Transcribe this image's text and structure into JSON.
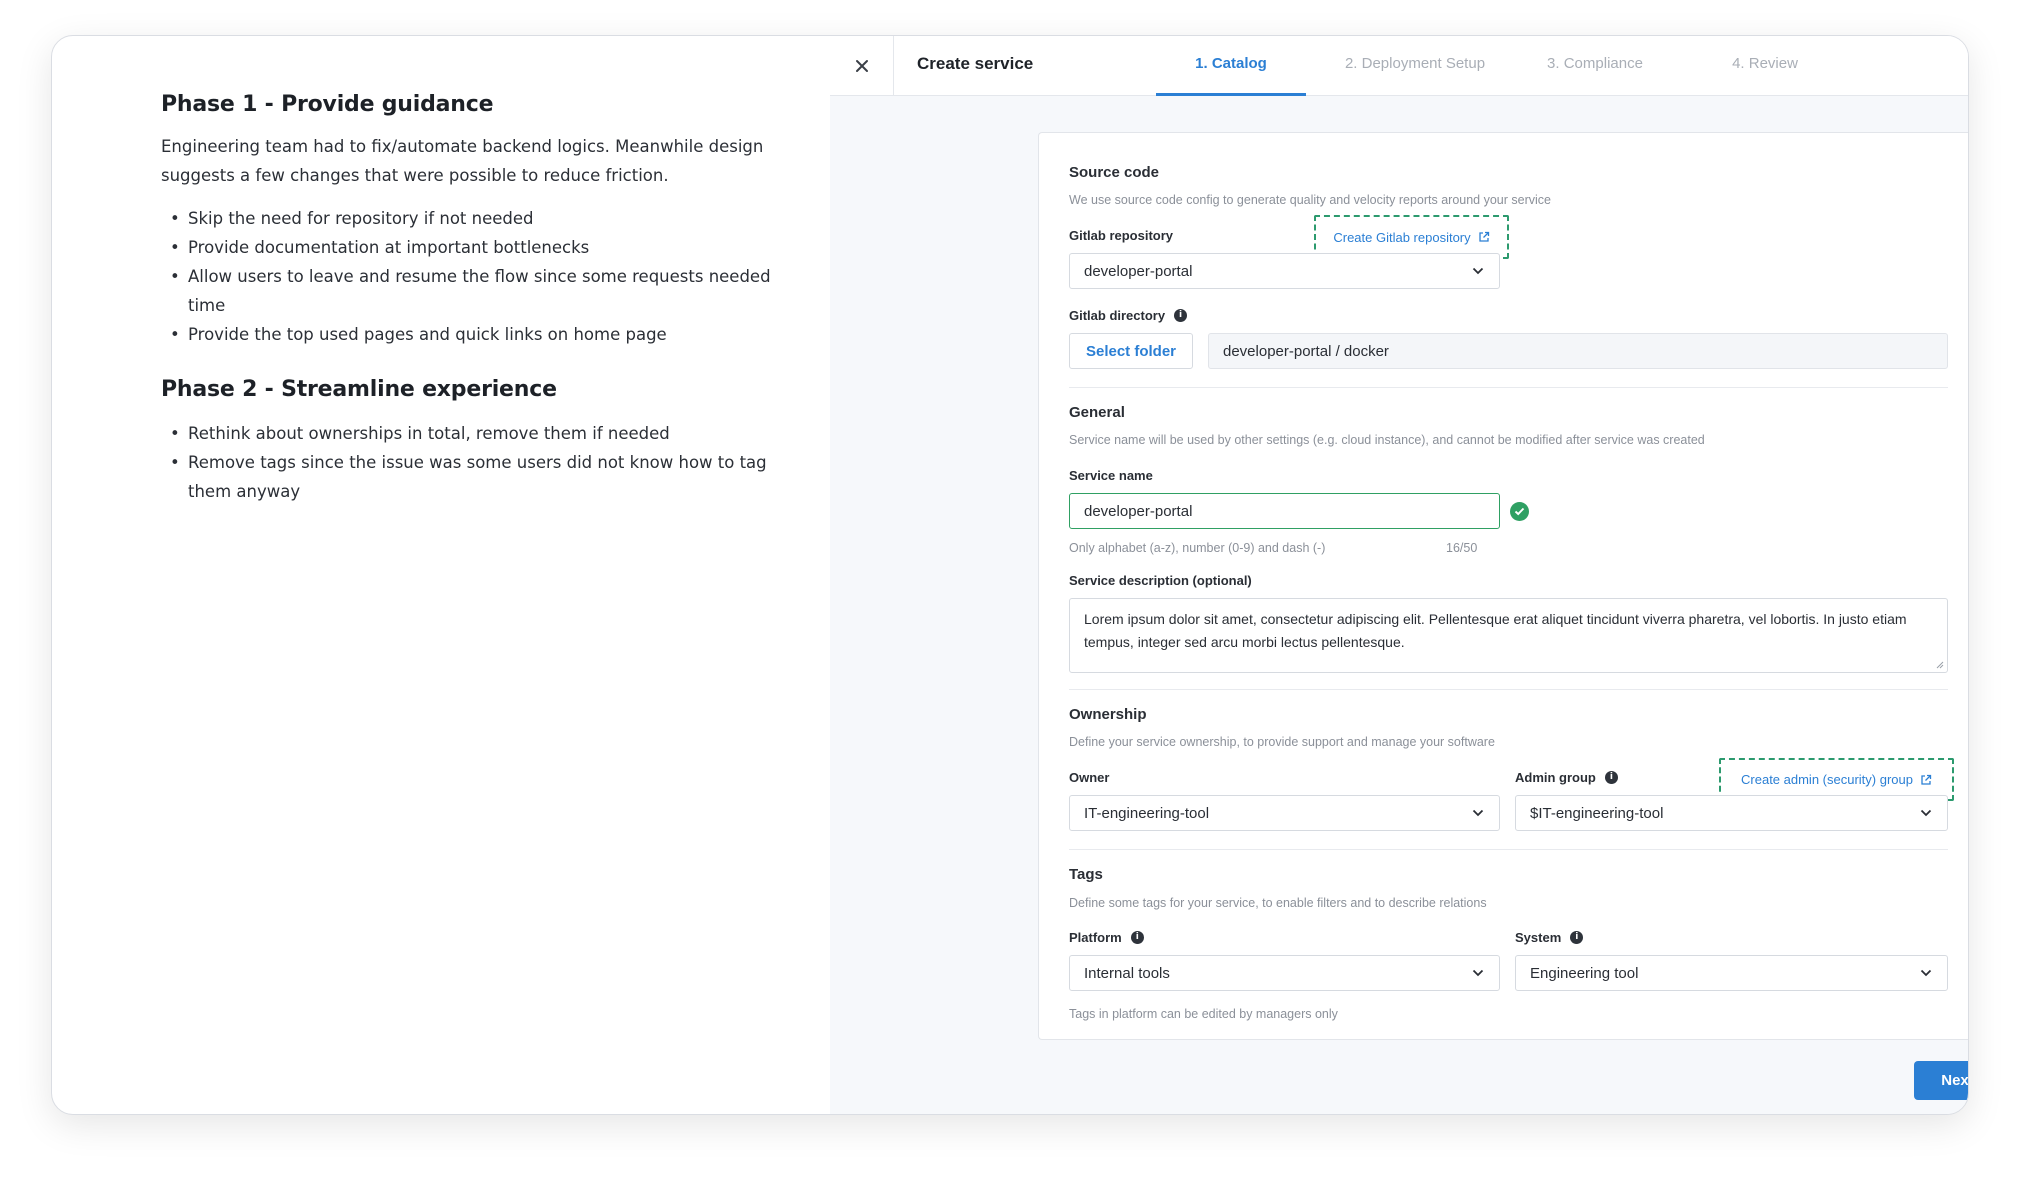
{
  "notes": {
    "phase1": {
      "title": "Phase 1 - Provide guidance",
      "paragraph": "Engineering team had to fix/automate backend logics. Meanwhile design suggests a few changes that were possible to reduce friction.",
      "bullets": [
        "Skip the need for repository if not needed",
        "Provide documentation at important bottlenecks",
        "Allow users to leave and resume the flow since some requests needed time",
        "Provide the top used pages and quick links on home page"
      ]
    },
    "phase2": {
      "title": "Phase 2 - Streamline experience",
      "bullets": [
        "Rethink about ownerships in total, remove them if needed",
        "Remove tags since the issue was some users did not know how to tag them anyway"
      ]
    }
  },
  "header": {
    "title": "Create service",
    "tabs": [
      {
        "label": "1. Catalog",
        "active": true
      },
      {
        "label": "2. Deployment Setup",
        "active": false
      },
      {
        "label": "3. Compliance",
        "active": false
      },
      {
        "label": "4. Review",
        "active": false
      }
    ]
  },
  "source_code": {
    "title": "Source code",
    "desc": "We use source code config to generate quality and velocity reports around your service",
    "repo_label": "Gitlab repository",
    "create_repo_link": "Create Gitlab repository",
    "repo_value": "developer-portal",
    "dir_label": "Gitlab directory",
    "select_folder": "Select folder",
    "dir_value": "developer-portal / docker"
  },
  "general": {
    "title": "General",
    "desc": "Service name will be used by other settings (e.g. cloud instance), and cannot be modified after service was created",
    "name_label": "Service name",
    "name_value": "developer-portal",
    "name_helper": "Only alphabet (a-z), number (0-9) and dash (-)",
    "name_count": "16/50",
    "desc_label": "Service description (optional)",
    "desc_value": "Lorem ipsum dolor sit amet, consectetur adipiscing elit. Pellentesque erat aliquet tincidunt viverra pharetra, vel lobortis. In justo etiam tempus, integer sed arcu morbi lectus pellentesque."
  },
  "ownership": {
    "title": "Ownership",
    "desc": "Define your service ownership, to provide support and manage your software",
    "owner_label": "Owner",
    "owner_value": "IT-engineering-tool",
    "admin_label": "Admin group",
    "create_admin_link": "Create admin (security) group",
    "admin_value": "$IT-engineering-tool"
  },
  "tags": {
    "title": "Tags",
    "desc": "Define some tags for your service, to enable filters and to describe relations",
    "platform_label": "Platform",
    "platform_value": "Internal tools",
    "system_label": "System",
    "system_value": "Engineering tool",
    "helper": "Tags in platform can be edited by managers only"
  },
  "footer": {
    "next_label": "Next"
  },
  "colors": {
    "accent": "#2b7fd4",
    "success": "#2fa063",
    "dashed_highlight": "#2c9a6e"
  }
}
